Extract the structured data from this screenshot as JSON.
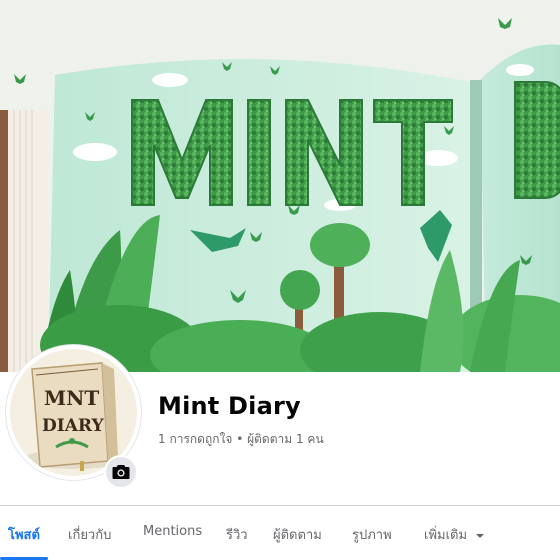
{
  "cover": {
    "artwork_title": "MINT D",
    "colors": {
      "mint": "#bfe8d6",
      "leaf": "#3f9a4a",
      "dark_leaf": "#2c7a37"
    }
  },
  "profile": {
    "name": "Mint Diary",
    "likes": "1 การกดถูกใจ",
    "separator": " • ",
    "followers": "ผู้ติดตาม 1 คน",
    "avatar_book_line1": "MNT",
    "avatar_book_line2": "DIARY"
  },
  "tabs": [
    {
      "label": "โพสต์"
    },
    {
      "label": "เกี่ยวกับ"
    },
    {
      "label": "Mentions"
    },
    {
      "label": "รีวิว"
    },
    {
      "label": "ผู้ติดตาม"
    },
    {
      "label": "รูปภาพ"
    },
    {
      "label": "เพิ่มเติม"
    }
  ],
  "colors": {
    "accent": "#1877f2",
    "muted_text": "#65676b",
    "name_text": "#050505"
  },
  "icons": {
    "camera": "camera-icon",
    "more": "caret-down-icon"
  }
}
